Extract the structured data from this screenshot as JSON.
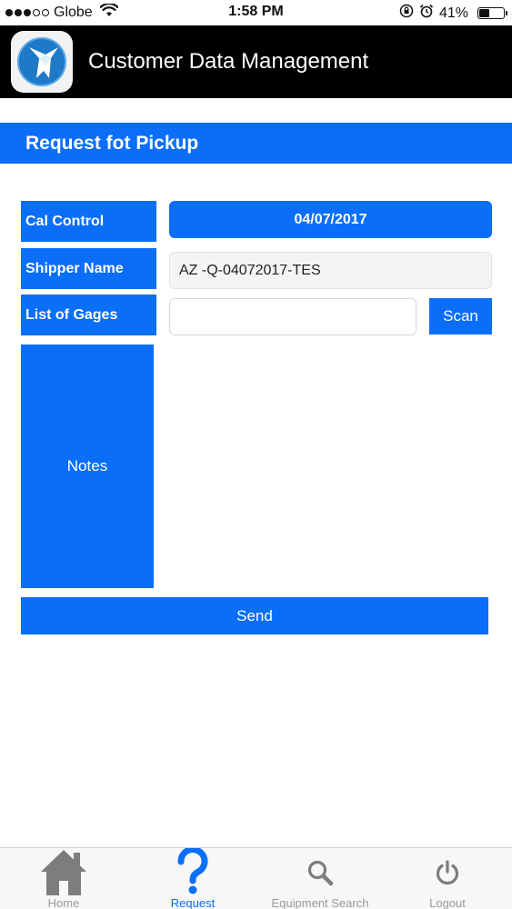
{
  "status_bar": {
    "carrier": "Globe",
    "time": "1:58 PM",
    "battery_percent": "41%",
    "battery_level": 0.41,
    "signal_bars_filled": 3,
    "signal_bars_total": 5
  },
  "header": {
    "title": "Customer Data Management",
    "logo_icon": "wolf-logo-icon"
  },
  "section": {
    "title": "Request fot Pickup"
  },
  "form": {
    "cal_control_label": "Cal Control",
    "cal_control_value": "04/07/2017",
    "shipper_name_label": "Shipper Name",
    "shipper_name_value": "AZ -Q-04072017-TES",
    "list_of_gages_label": "List of Gages",
    "list_of_gages_value": "",
    "scan_label": "Scan",
    "notes_label": "Notes",
    "notes_value": "",
    "send_label": "Send"
  },
  "tabs": [
    {
      "label": "Home",
      "icon": "home-icon",
      "active": false
    },
    {
      "label": "Request",
      "icon": "question-icon",
      "active": true
    },
    {
      "label": "Equipment Search",
      "icon": "search-icon",
      "active": false
    },
    {
      "label": "Logout",
      "icon": "power-icon",
      "active": false
    }
  ],
  "colors": {
    "accent": "#0a6ef9",
    "header_bg": "#000000",
    "tab_inactive": "#9a9a9a"
  }
}
